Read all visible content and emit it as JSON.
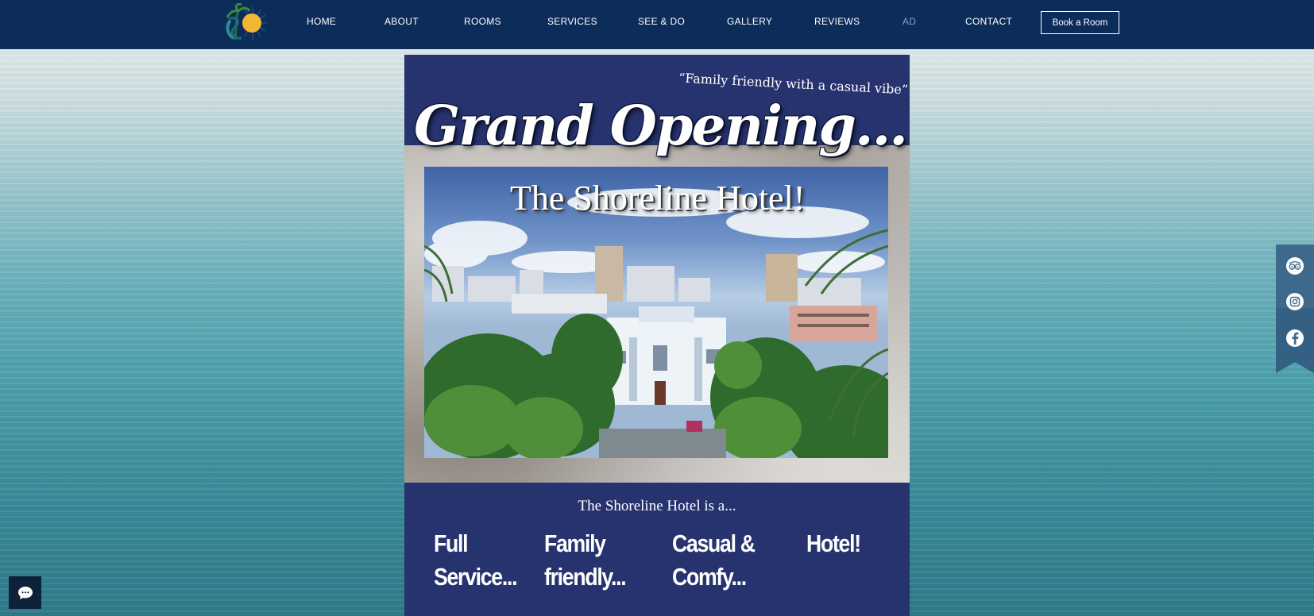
{
  "nav": {
    "items": [
      {
        "label": "HOME",
        "dim": false
      },
      {
        "label": "ABOUT",
        "dim": false
      },
      {
        "label": "ROOMS",
        "dim": false
      },
      {
        "label": "SERVICES",
        "dim": false
      },
      {
        "label": "SEE & DO",
        "dim": false
      },
      {
        "label": "GALLERY",
        "dim": false
      },
      {
        "label": "REVIEWS",
        "dim": false
      },
      {
        "label": "AD",
        "dim": true
      },
      {
        "label": "CONTACT",
        "dim": false
      }
    ],
    "book_button": "Book a Room"
  },
  "poster": {
    "tagline": "“Family friendly with a casual vibe”",
    "headline": "Grand Opening...",
    "hotel_name": "The Shoreline Hotel!",
    "intro": "The Shoreline Hotel is a...",
    "features": [
      {
        "line1": "Full",
        "line2": "Service..."
      },
      {
        "line1": "Family",
        "line2": "friendly..."
      },
      {
        "line1": "Casual &",
        "line2": "Comfy..."
      },
      {
        "line1": "Hotel!",
        "line2": ""
      }
    ]
  },
  "social": {
    "icons": [
      "tripadvisor-icon",
      "instagram-icon",
      "facebook-icon"
    ]
  },
  "colors": {
    "nav_bg": "#0c2c5a",
    "poster_bg": "#27336f",
    "social_bar": "#3d6a8c"
  }
}
